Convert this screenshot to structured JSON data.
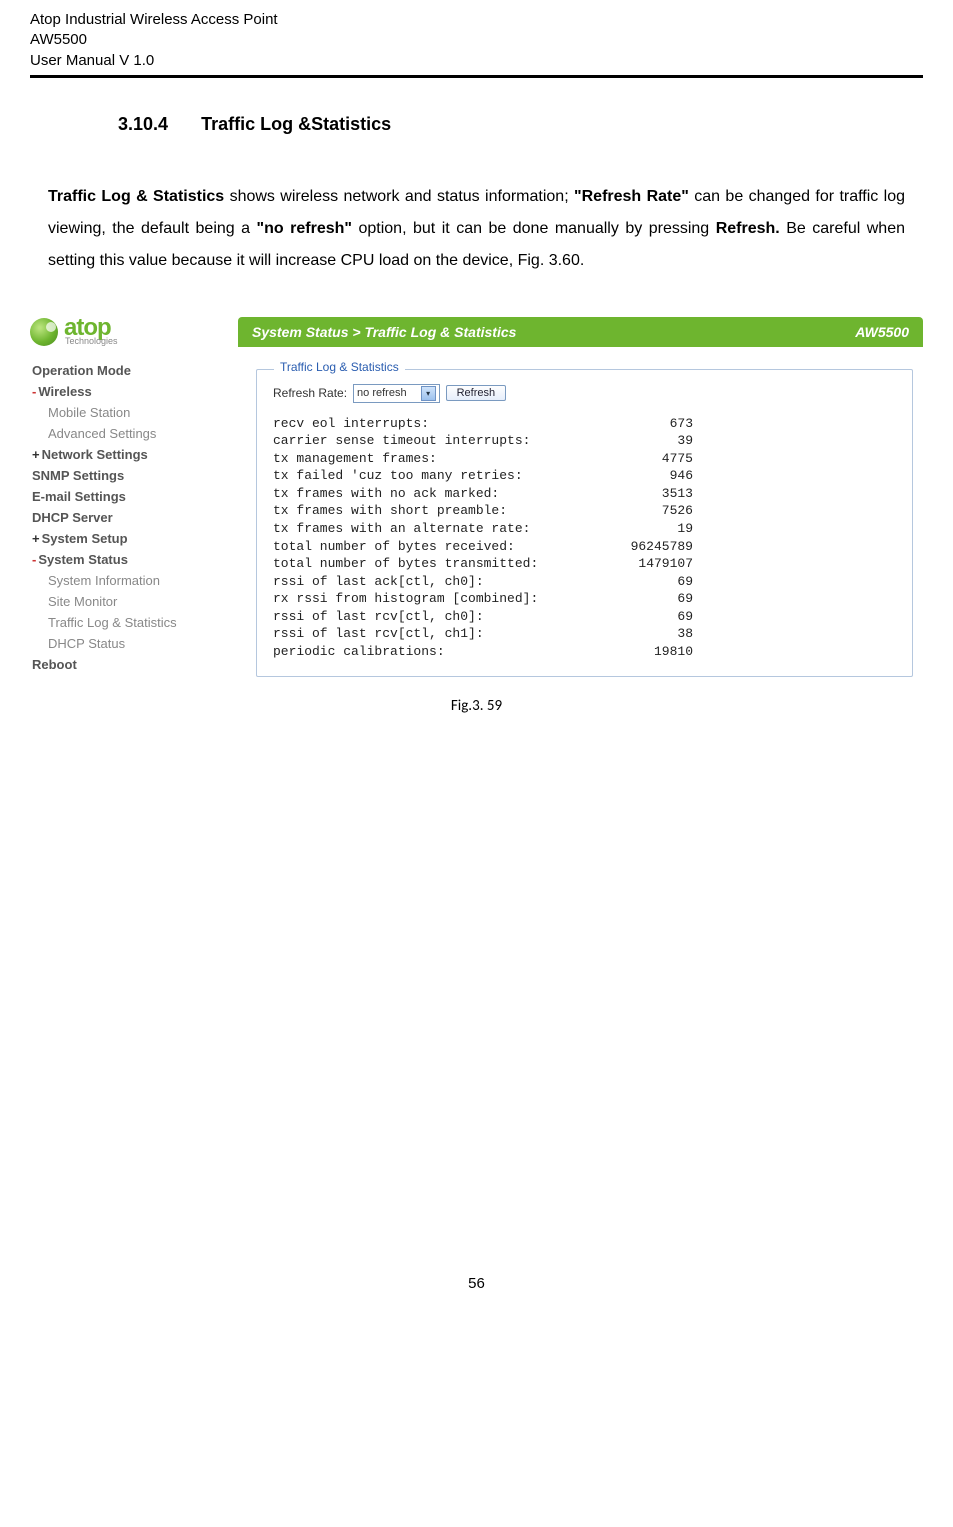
{
  "header": {
    "line1": "Atop Industrial Wireless Access Point",
    "line2": "AW5500",
    "line3": "User Manual V 1.0"
  },
  "section": {
    "number": "3.10.4",
    "title": "Traffic Log &Statistics"
  },
  "paragraph": {
    "lead_bold": "Traffic Log & Statistics",
    "t1": " shows wireless network and status information; ",
    "b2": "\"Refresh Rate\"",
    "t2": " can be changed for traffic log viewing, the default being a ",
    "b3": "\"no refresh\"",
    "t3": " option, but it can be done manually by pressing ",
    "b4": "Refresh.",
    "t4": " Be careful when setting this value because it will increase CPU load on the device, Fig. 3.60."
  },
  "logo": {
    "brand": "atop",
    "sub": "Technologies"
  },
  "nav": {
    "operation_mode": "Operation Mode",
    "wireless": "Wireless",
    "mobile_station": "Mobile Station",
    "advanced_settings": "Advanced Settings",
    "network_settings": "Network Settings",
    "snmp_settings": "SNMP Settings",
    "email_settings": "E-mail Settings",
    "dhcp_server": "DHCP Server",
    "system_setup": "System Setup",
    "system_status": "System Status",
    "system_information": "System Information",
    "site_monitor": "Site Monitor",
    "traffic_log": "Traffic Log & Statistics",
    "dhcp_status": "DHCP Status",
    "reboot": "Reboot"
  },
  "panel": {
    "breadcrumb": "System Status > Traffic Log & Statistics",
    "model": "AW5500",
    "legend": "Traffic Log & Statistics",
    "refresh_label": "Refresh Rate:",
    "select_value": "no refresh",
    "refresh_btn": "Refresh"
  },
  "stats": [
    {
      "label": "recv eol interrupts:",
      "value": "673"
    },
    {
      "label": "carrier sense timeout interrupts:",
      "value": "39"
    },
    {
      "label": "tx management frames:",
      "value": "4775"
    },
    {
      "label": "tx failed 'cuz too many retries:",
      "value": "946"
    },
    {
      "label": "tx frames with no ack marked:",
      "value": "3513"
    },
    {
      "label": "tx frames with short preamble:",
      "value": "7526"
    },
    {
      "label": "tx frames with an alternate rate:",
      "value": "19"
    },
    {
      "label": "total number of bytes received:",
      "value": "96245789"
    },
    {
      "label": "total number of bytes transmitted:",
      "value": "1479107"
    },
    {
      "label": "rssi of last ack[ctl, ch0]:",
      "value": "69"
    },
    {
      "label": "rx rssi from histogram [combined]:",
      "value": "69"
    },
    {
      "label": "rssi of last rcv[ctl, ch0]:",
      "value": "69"
    },
    {
      "label": "rssi of last rcv[ctl, ch1]:",
      "value": "38"
    },
    {
      "label": "periodic calibrations:",
      "value": "19810"
    }
  ],
  "caption": "Fig.3. 59",
  "page_number": "56"
}
